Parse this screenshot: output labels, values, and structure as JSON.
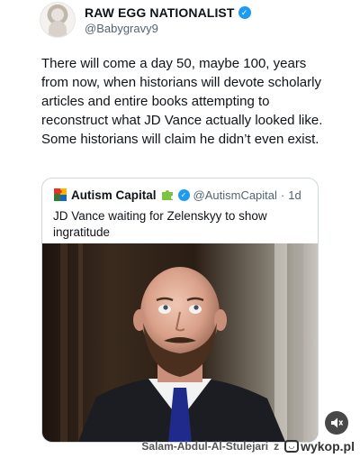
{
  "author": {
    "display_name": "RAW EGG NATIONALIST",
    "handle": "@Babygravy9",
    "verified_icon": "verified-badge-icon"
  },
  "tweet": {
    "text": "There will come a day 50, maybe 100, years from now, when historians will devote scholarly articles and entire books attempting to reconstruct what JD Vance actually looked like. Some historians will claim he didn’t even exist."
  },
  "quoted": {
    "display_name": "Autism Capital",
    "handle": "@AutismCapital",
    "separator": "·",
    "time": "1d",
    "text": "JD Vance waiting for Zelenskyy to show ingratitude",
    "icons": [
      "puzzle-icon",
      "puzzle-green-icon",
      "verified-badge-icon"
    ]
  },
  "media": {
    "mute_icon": "mute-speaker-icon"
  },
  "watermark": {
    "user": "Salam-Abdul-Al-Stulejari",
    "letter": "z",
    "site": "wykop.pl"
  },
  "colors": {
    "verified_blue": "#1d9bf0",
    "secondary_text": "#536471",
    "border": "#cfd9de"
  }
}
